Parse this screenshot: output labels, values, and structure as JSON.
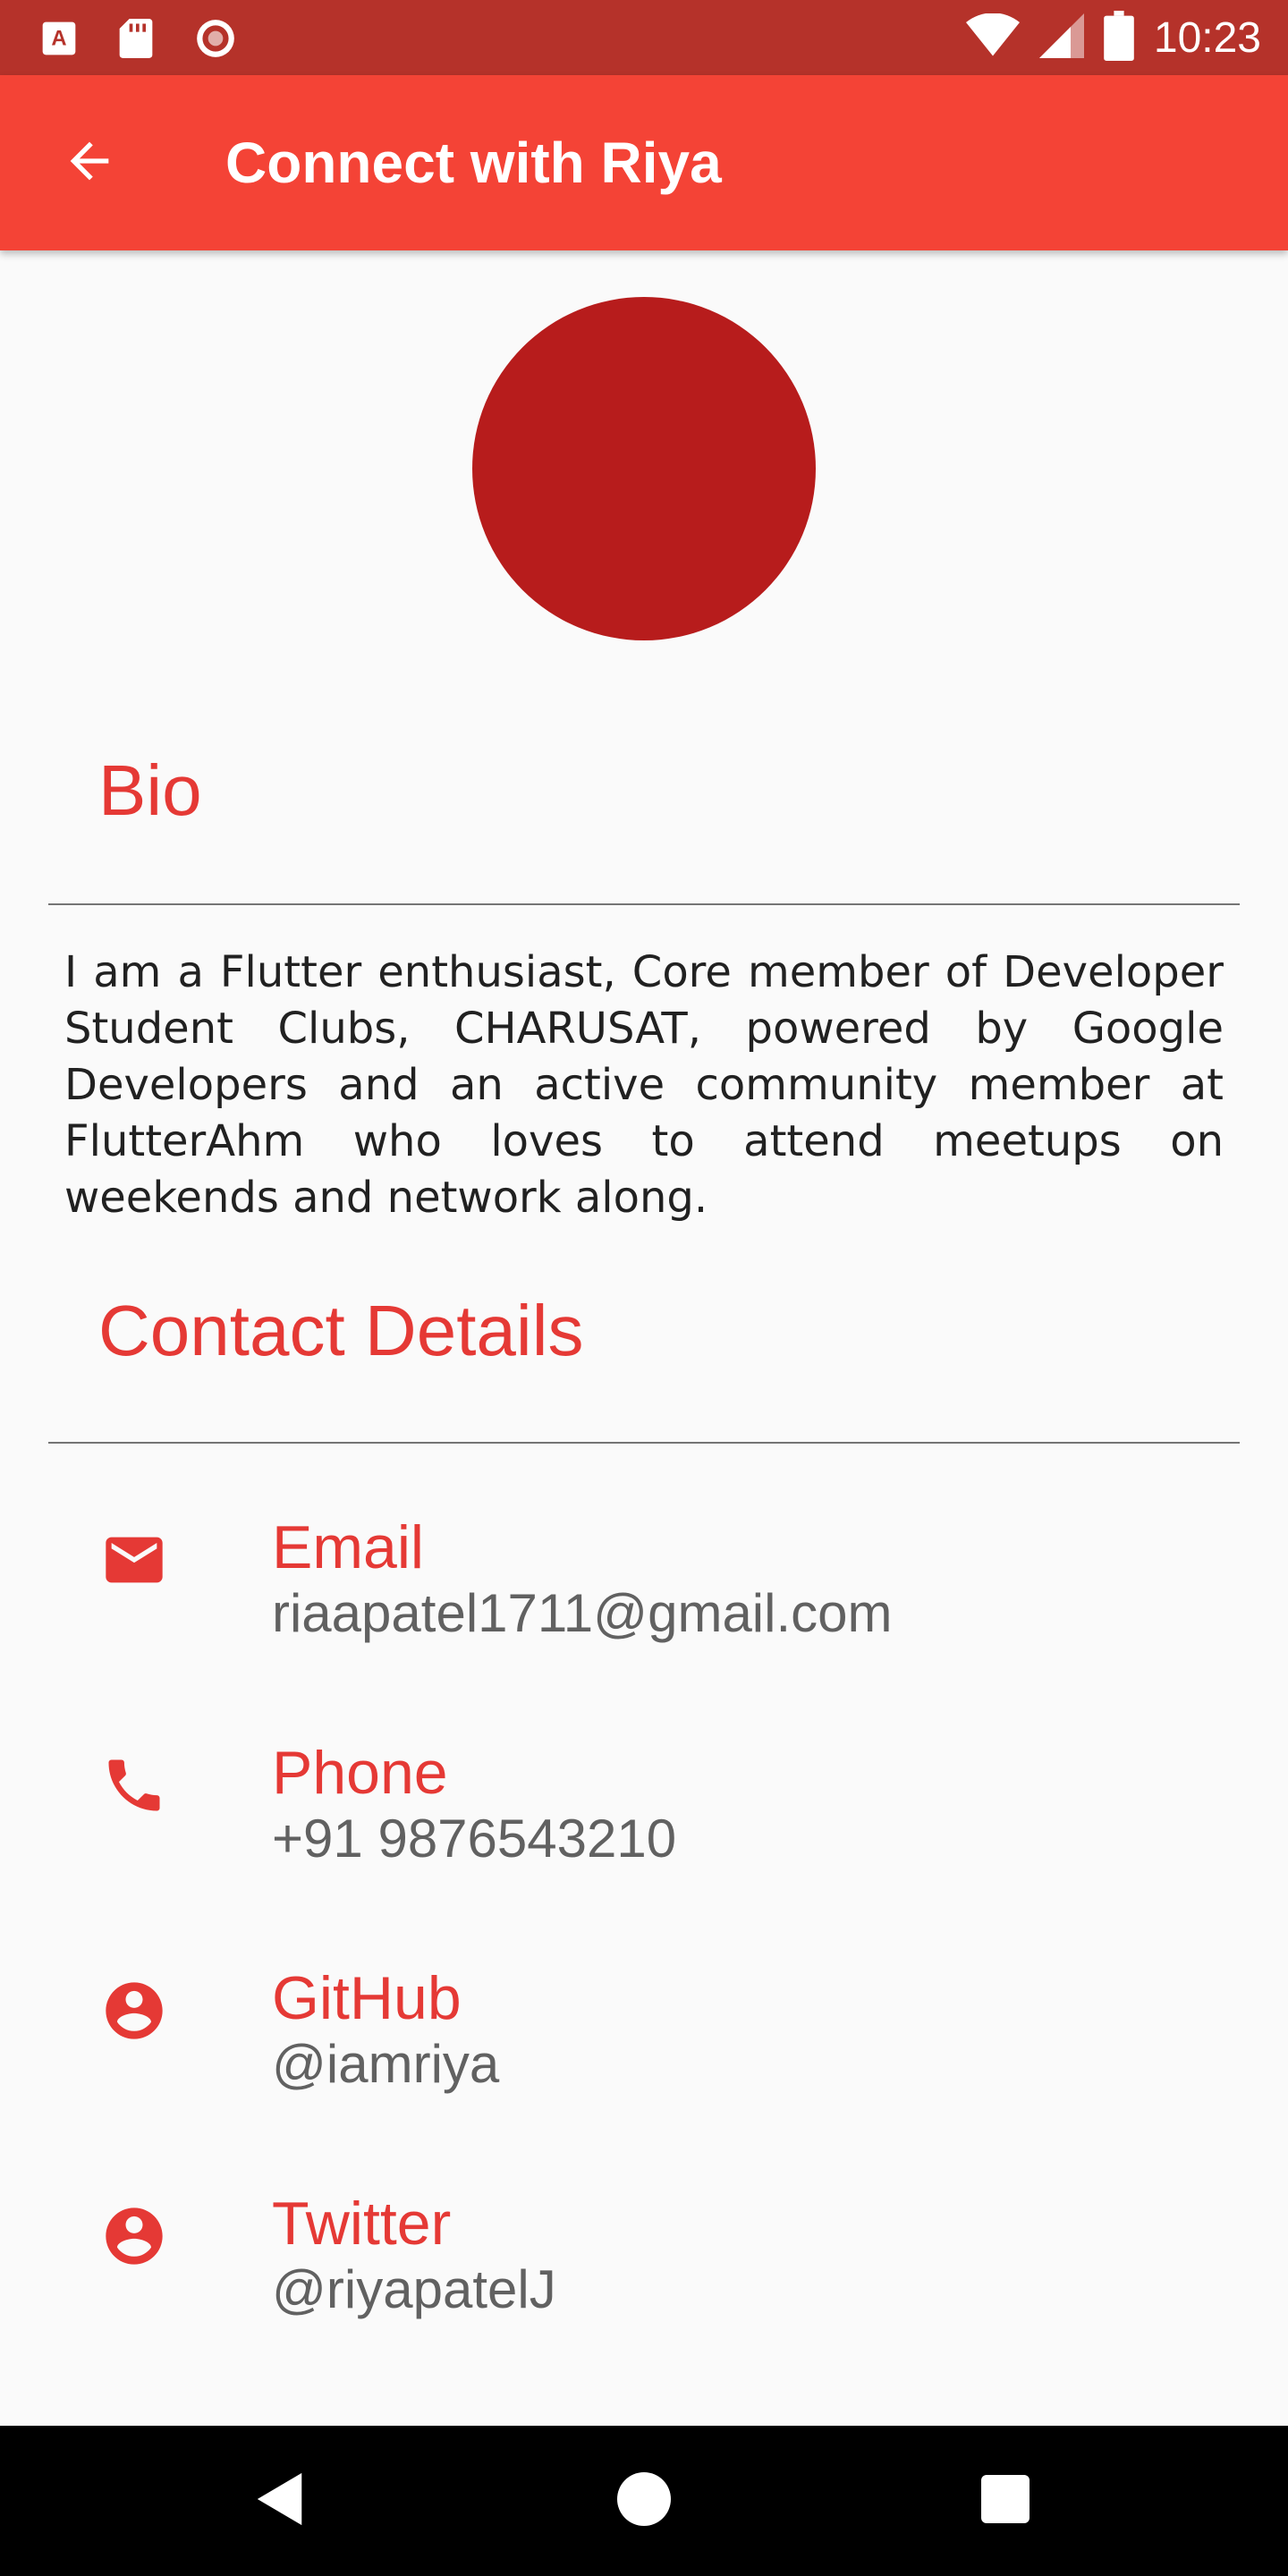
{
  "status_bar": {
    "time": "10:23",
    "icons_left": [
      "text-a-icon",
      "sd-card-icon",
      "record-icon"
    ],
    "icons_right": [
      "wifi-icon",
      "cell-signal-icon",
      "battery-icon"
    ]
  },
  "app_bar": {
    "title": "Connect with Riya",
    "back_icon": "arrow-back-icon",
    "color": "#f44336"
  },
  "avatar": {
    "color": "#b71c1c"
  },
  "bio": {
    "heading": "Bio",
    "text": "I am a Flutter enthusiast, Core member of Developer Student Clubs, CHARUSAT, powered by Google Developers and an active community member at FlutterAhm who loves to attend meetups on weekends and network along."
  },
  "contact": {
    "heading": "Contact Details",
    "items": [
      {
        "label": "Email",
        "value": "riaapatel1711@gmail.com",
        "icon": "email-icon"
      },
      {
        "label": "Phone",
        "value": "+91 9876543210",
        "icon": "phone-icon"
      },
      {
        "label": "GitHub",
        "value": "@iamriya",
        "icon": "account-circle-icon"
      },
      {
        "label": "Twitter",
        "value": "@riyapatelJ",
        "icon": "account-circle-icon"
      }
    ]
  },
  "nav_bar": {
    "buttons": [
      "back-triangle-icon",
      "home-circle-icon",
      "recents-square-icon"
    ]
  },
  "colors": {
    "accent": "#e53935",
    "status_bar": "#b5322a",
    "background": "#fafafa"
  }
}
